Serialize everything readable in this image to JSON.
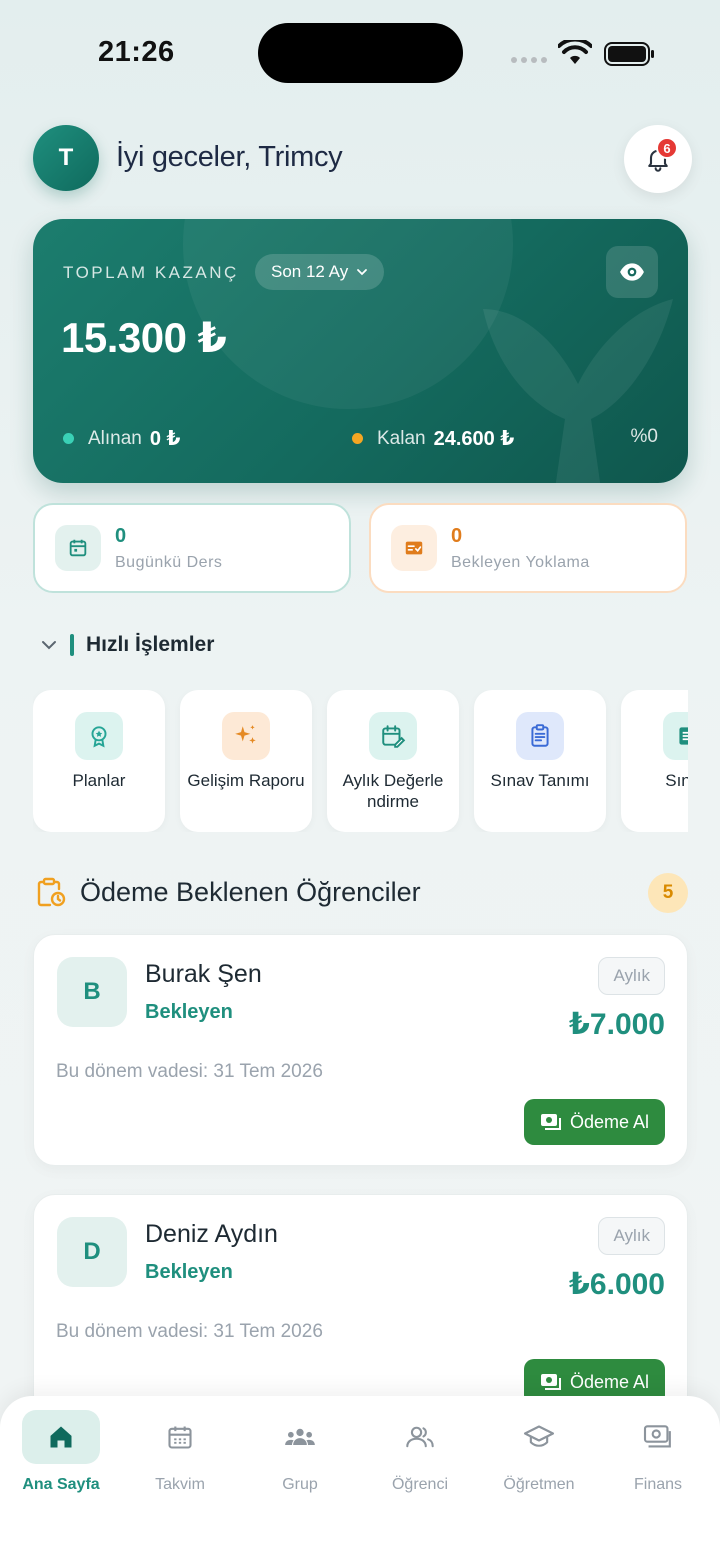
{
  "status_bar": {
    "time": "21:26"
  },
  "header": {
    "avatar_initial": "T",
    "greeting": "İyi geceler, Trimcy",
    "notification_count": "6"
  },
  "earnings": {
    "label": "TOPLAM KAZANÇ",
    "period": "Son 12 Ay",
    "amount": "15.300 ₺",
    "received_label": "Alınan",
    "received_value": "0 ₺",
    "remaining_label": "Kalan",
    "remaining_value": "24.600 ₺",
    "percent": "%0",
    "colors": {
      "received": "#3ad1b6",
      "remaining": "#f5a623"
    }
  },
  "stats": {
    "today_lessons": {
      "value": "0",
      "label": "Bugünkü Ders"
    },
    "pending_attendance": {
      "value": "0",
      "label": "Bekleyen Yoklama"
    }
  },
  "quick_actions": {
    "title": "Hızlı İşlemler",
    "items": [
      {
        "label": "Planlar",
        "icon": "award-icon"
      },
      {
        "label": "Gelişim Raporu",
        "icon": "sparkles-icon"
      },
      {
        "label": "Aylık Değerle ndirme",
        "icon": "calendar-edit-icon"
      },
      {
        "label": "Sınav Tanımı",
        "icon": "clipboard-icon"
      },
      {
        "label": "Sınav",
        "icon": "list-icon"
      }
    ]
  },
  "payments": {
    "title": "Ödeme Beklenen Öğrenciler",
    "count": "5",
    "students": [
      {
        "initial": "B",
        "name": "Burak Şen",
        "status": "Bekleyen",
        "type": "Aylık",
        "amount": "₺7.000",
        "due": "Bu dönem vadesi: 31 Tem 2026",
        "button": "Ödeme Al"
      },
      {
        "initial": "D",
        "name": "Deniz Aydın",
        "status": "Bekleyen",
        "type": "Aylık",
        "amount": "₺6.000",
        "due": "Bu dönem vadesi: 31 Tem 2026",
        "button": "Ödeme Al"
      }
    ]
  },
  "nav": {
    "items": [
      {
        "label": "Ana Sayfa",
        "icon": "home-icon",
        "active": true
      },
      {
        "label": "Takvim",
        "icon": "calendar-icon"
      },
      {
        "label": "Grup",
        "icon": "group-icon"
      },
      {
        "label": "Öğrenci",
        "icon": "students-icon"
      },
      {
        "label": "Öğretmen",
        "icon": "graduation-cap-icon"
      },
      {
        "label": "Finans",
        "icon": "money-icon"
      }
    ]
  },
  "theme": {
    "primary": "#1f8f7e",
    "accent": "#f5a623",
    "pay_button": "#2e8b3f"
  }
}
